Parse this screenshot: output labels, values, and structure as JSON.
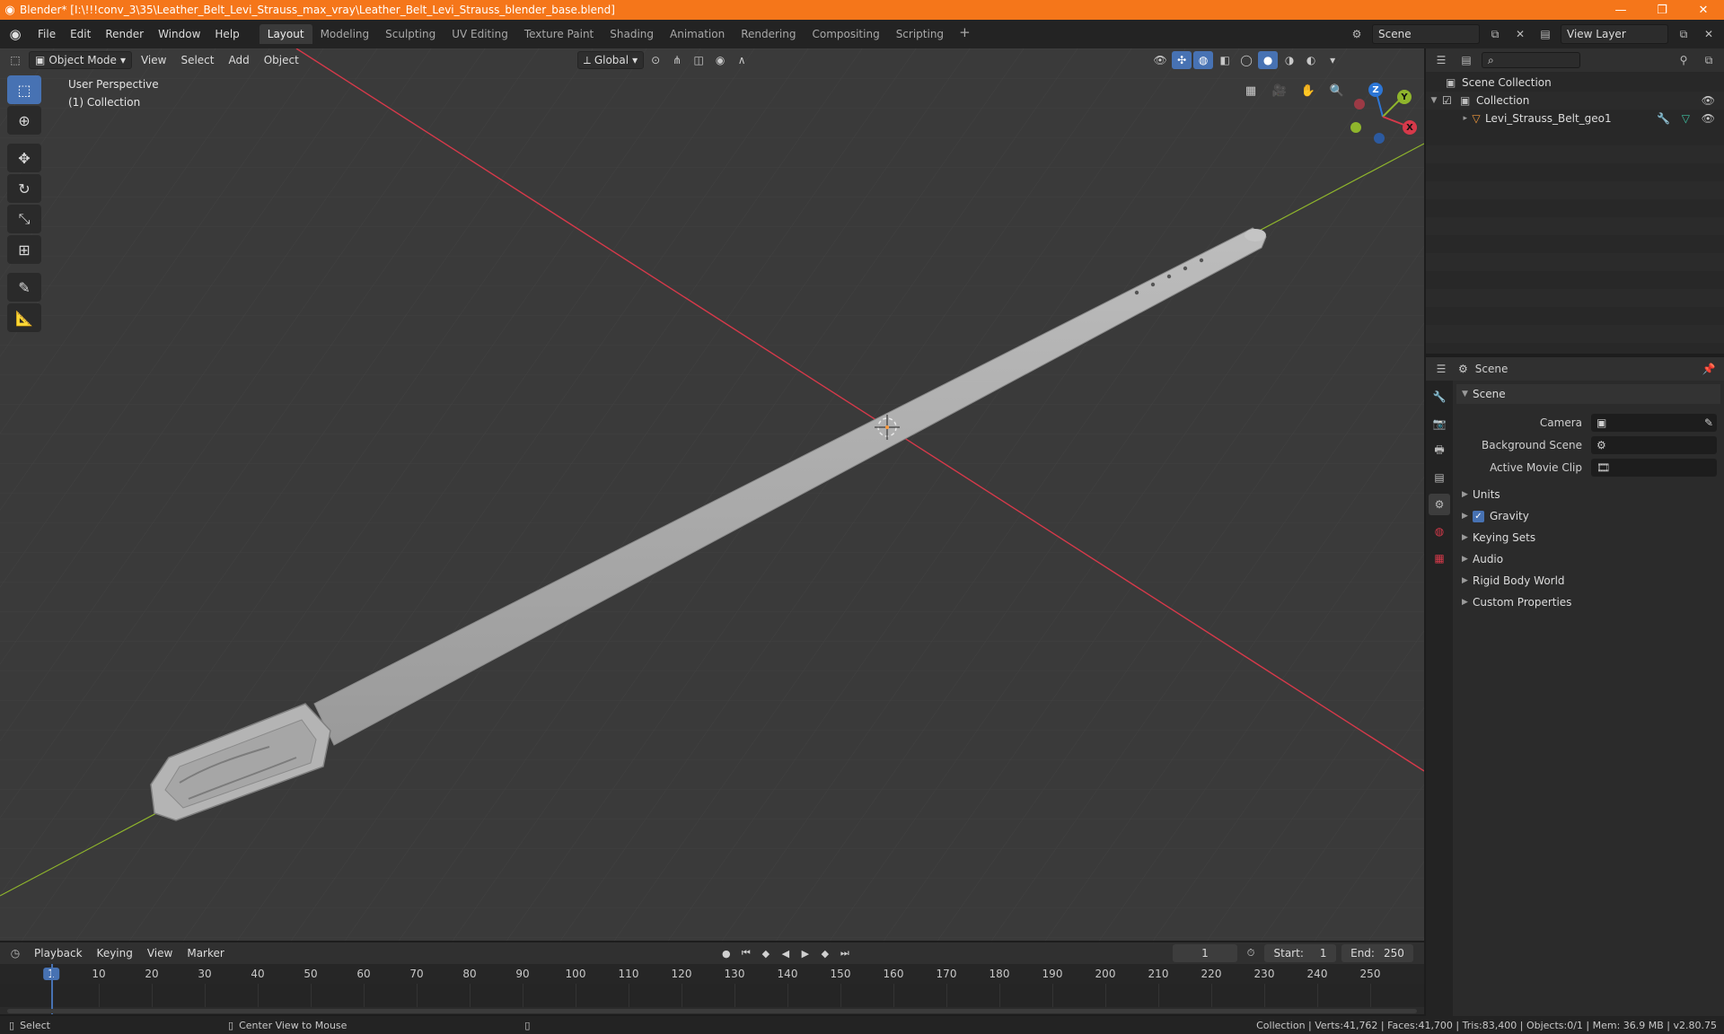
{
  "window": {
    "title": "Blender* [I:\\!!!conv_3\\35\\Leather_Belt_Levi_Strauss_max_vray\\Leather_Belt_Levi_Strauss_blender_base.blend]",
    "minimize": "—",
    "restore": "❐",
    "close": "✕"
  },
  "menu": [
    "File",
    "Edit",
    "Render",
    "Window",
    "Help"
  ],
  "workspaces": {
    "active": "Layout",
    "tabs": [
      "Layout",
      "Modeling",
      "Sculpting",
      "UV Editing",
      "Texture Paint",
      "Shading",
      "Animation",
      "Rendering",
      "Compositing",
      "Scripting"
    ],
    "add": "+"
  },
  "scene_field": "Scene",
  "view_layer_field": "View Layer",
  "viewport": {
    "mode": "Object Mode",
    "menus": [
      "View",
      "Select",
      "Add",
      "Object"
    ],
    "orientation": "Global",
    "info_line1": "User Perspective",
    "info_line2": "(1) Collection",
    "gizmo": {
      "x": "X",
      "y": "Y",
      "z": "Z"
    }
  },
  "outliner": {
    "root": "Scene Collection",
    "collection": "Collection",
    "object": "Levi_Strauss_Belt_geo1"
  },
  "properties": {
    "context": "Scene",
    "section": "Scene",
    "fields": [
      {
        "label": "Camera"
      },
      {
        "label": "Background Scene"
      },
      {
        "label": "Active Movie Clip"
      }
    ],
    "subsections": [
      "Units",
      "Gravity",
      "Keying Sets",
      "Audio",
      "Rigid Body World",
      "Custom Properties"
    ]
  },
  "timeline": {
    "menus": [
      "Playback",
      "Keying",
      "View",
      "Marker"
    ],
    "current_frame": "1",
    "start_label": "Start:",
    "start": "1",
    "end_label": "End:",
    "end": "250",
    "ticks": [
      "1",
      "10",
      "20",
      "30",
      "40",
      "50",
      "60",
      "70",
      "80",
      "90",
      "100",
      "110",
      "120",
      "130",
      "140",
      "150",
      "160",
      "170",
      "180",
      "190",
      "200",
      "210",
      "220",
      "230",
      "240",
      "250"
    ]
  },
  "status": {
    "left1": "Select",
    "left2": "Center View to Mouse",
    "right": "Collection | Verts:41,762 | Faces:41,700 | Tris:83,400 | Objects:0/1 | Mem: 36.9 MB | v2.80.75"
  },
  "colors": {
    "accent": "#4772b3",
    "titlebar": "#f5761a",
    "axis_x": "#d6394a",
    "axis_y": "#8fb52c",
    "axis_z": "#2c76d6"
  }
}
